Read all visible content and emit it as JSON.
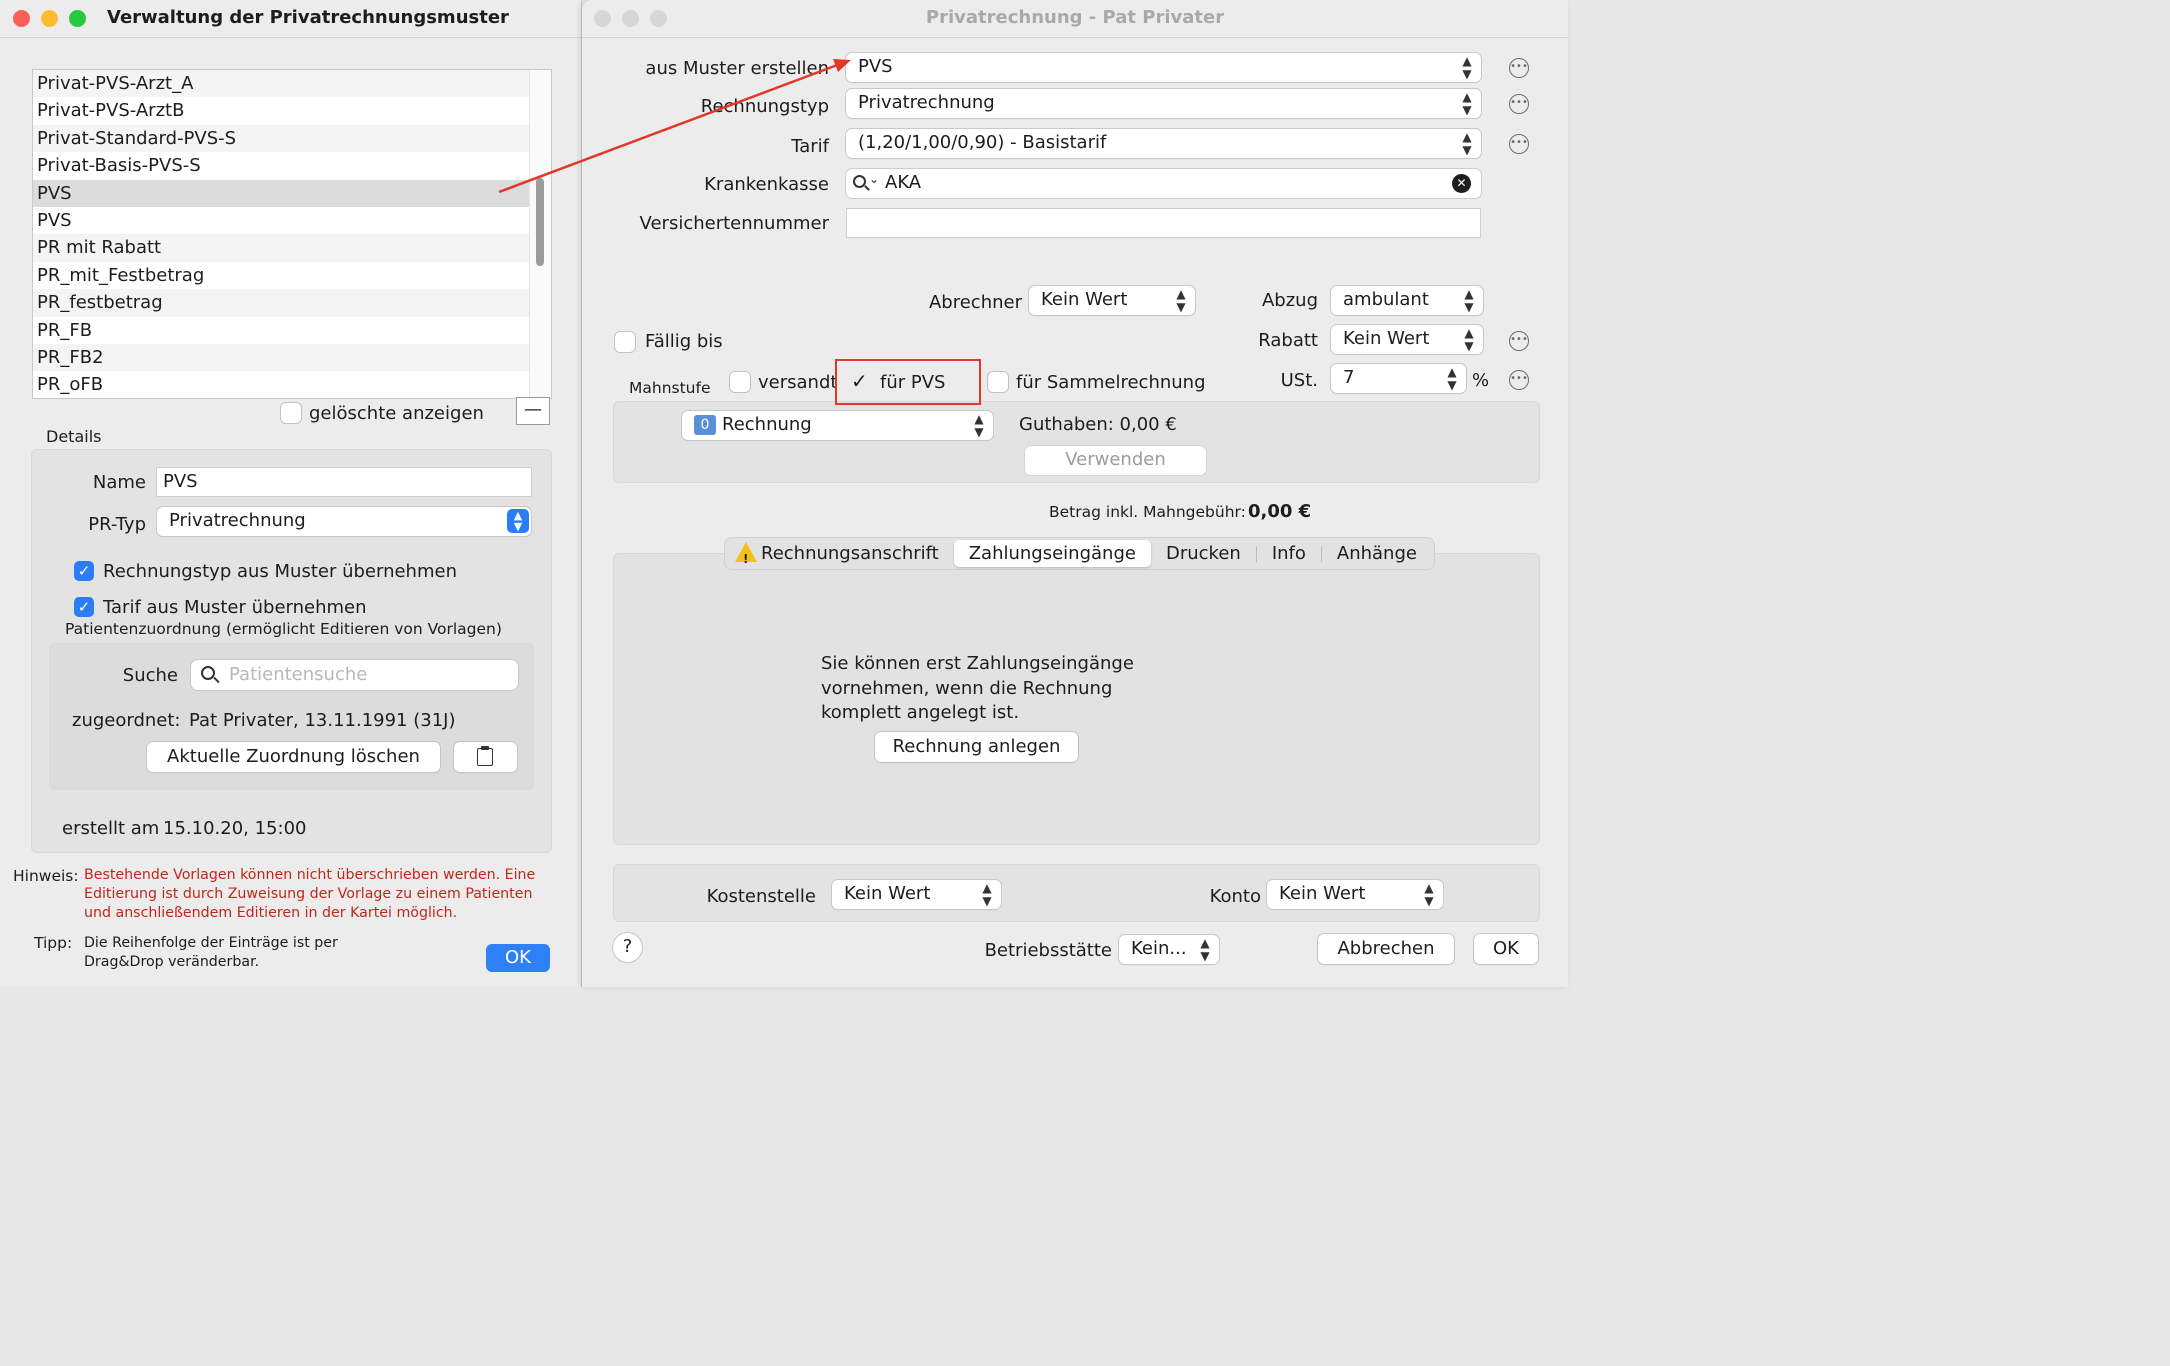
{
  "left_window": {
    "title": "Verwaltung der Privatrechnungsmuster",
    "list_items": [
      "Privat-PVS-Arzt_A",
      "Privat-PVS-ArztB",
      "Privat-Standard-PVS-S",
      "Privat-Basis-PVS-S",
      "PVS",
      "PVS",
      "PR mit Rabatt",
      "PR_mit_Festbetrag",
      "PR_festbetrag",
      "PR_FB",
      "PR_FB2",
      "PR_oFB"
    ],
    "selected_index": 4,
    "show_deleted_label": "gelöschte anzeigen",
    "remove_button": "—",
    "details_label": "Details",
    "name_label": "Name",
    "name_value": "PVS",
    "pr_type_label": "PR-Typ",
    "pr_type_value": "Privatrechnung",
    "checkbox_rechnungstyp": "Rechnungstyp aus Muster übernehmen",
    "checkbox_tarif": "Tarif aus Muster übernehmen",
    "patient_assignment_label": "Patientenzuordnung (ermöglicht Editieren von Vorlagen)",
    "search_label": "Suche",
    "search_placeholder": "Patientensuche",
    "assigned_label": "zugeordnet:",
    "assigned_value": "Pat Privater, 13.11.1991 (31J)",
    "clear_assignment_button": "Aktuelle Zuordnung löschen",
    "created_label": "erstellt am",
    "created_value": "15.10.20, 15:00",
    "hint_label": "Hinweis:",
    "hint_text": "Bestehende Vorlagen können nicht überschrieben werden. Eine Editierung ist durch Zuweisung der Vorlage zu einem Patienten und anschließendem Editieren in der Kartei möglich.",
    "tip_label": "Tipp:",
    "tip_text": "Die Reihenfolge der Einträge ist per Drag&Drop veränderbar.",
    "ok_button": "OK"
  },
  "right_window": {
    "title": "Privatrechnung - Pat Privater",
    "from_template_label": "aus Muster erstellen",
    "from_template_value": "PVS",
    "invoice_type_label": "Rechnungstyp",
    "invoice_type_value": "Privatrechnung",
    "tariff_label": "Tarif",
    "tariff_value": "(1,20/1,00/0,90) - Basistarif",
    "insurance_label": "Krankenkasse",
    "insurance_value": "AKA",
    "insured_number_label": "Versichertennummer",
    "insured_number_value": "",
    "biller_label": "Abrechner",
    "biller_value": "Kein Wert",
    "deduction_label": "Abzug",
    "deduction_value": "ambulant",
    "due_label": "Fällig bis",
    "discount_label": "Rabatt",
    "discount_value": "Kein Wert",
    "dunning_label": "Mahnstufe",
    "sent_label": "versandt",
    "for_pvs_label": "für PVS",
    "collective_label": "für Sammelrechnung",
    "vat_label": "USt.",
    "vat_value": "7",
    "vat_unit": "%",
    "doc_badge": "0",
    "doc_value": "Rechnung",
    "credit_text": "Guthaben: 0,00 €",
    "use_button": "Verwenden",
    "amount_label": "Betrag inkl. Mahngebühr:",
    "amount_value": "0,00 €",
    "tabs": [
      "Rechnungsanschrift",
      "Zahlungseingänge",
      "Drucken",
      "Info",
      "Anhänge"
    ],
    "active_tab": 1,
    "payments_info": [
      "Sie können erst Zahlungseingänge",
      "vornehmen, wenn die Rechnung",
      "komplett angelegt ist."
    ],
    "create_invoice_button": "Rechnung anlegen",
    "cost_center_label": "Kostenstelle",
    "cost_center_value": "Kein Wert",
    "account_label": "Konto",
    "account_value": "Kein Wert",
    "help_button": "?",
    "site_label": "Betriebsstätte",
    "site_value": "Kein...",
    "cancel_button": "Abbrechen",
    "ok_button": "OK"
  },
  "colors": {
    "accent": "#2a7df6",
    "annotation": "#e0382b",
    "hint": "#c0271b",
    "traffic_close": "#fe5f57",
    "traffic_min": "#febc2e",
    "traffic_max": "#28c840"
  }
}
